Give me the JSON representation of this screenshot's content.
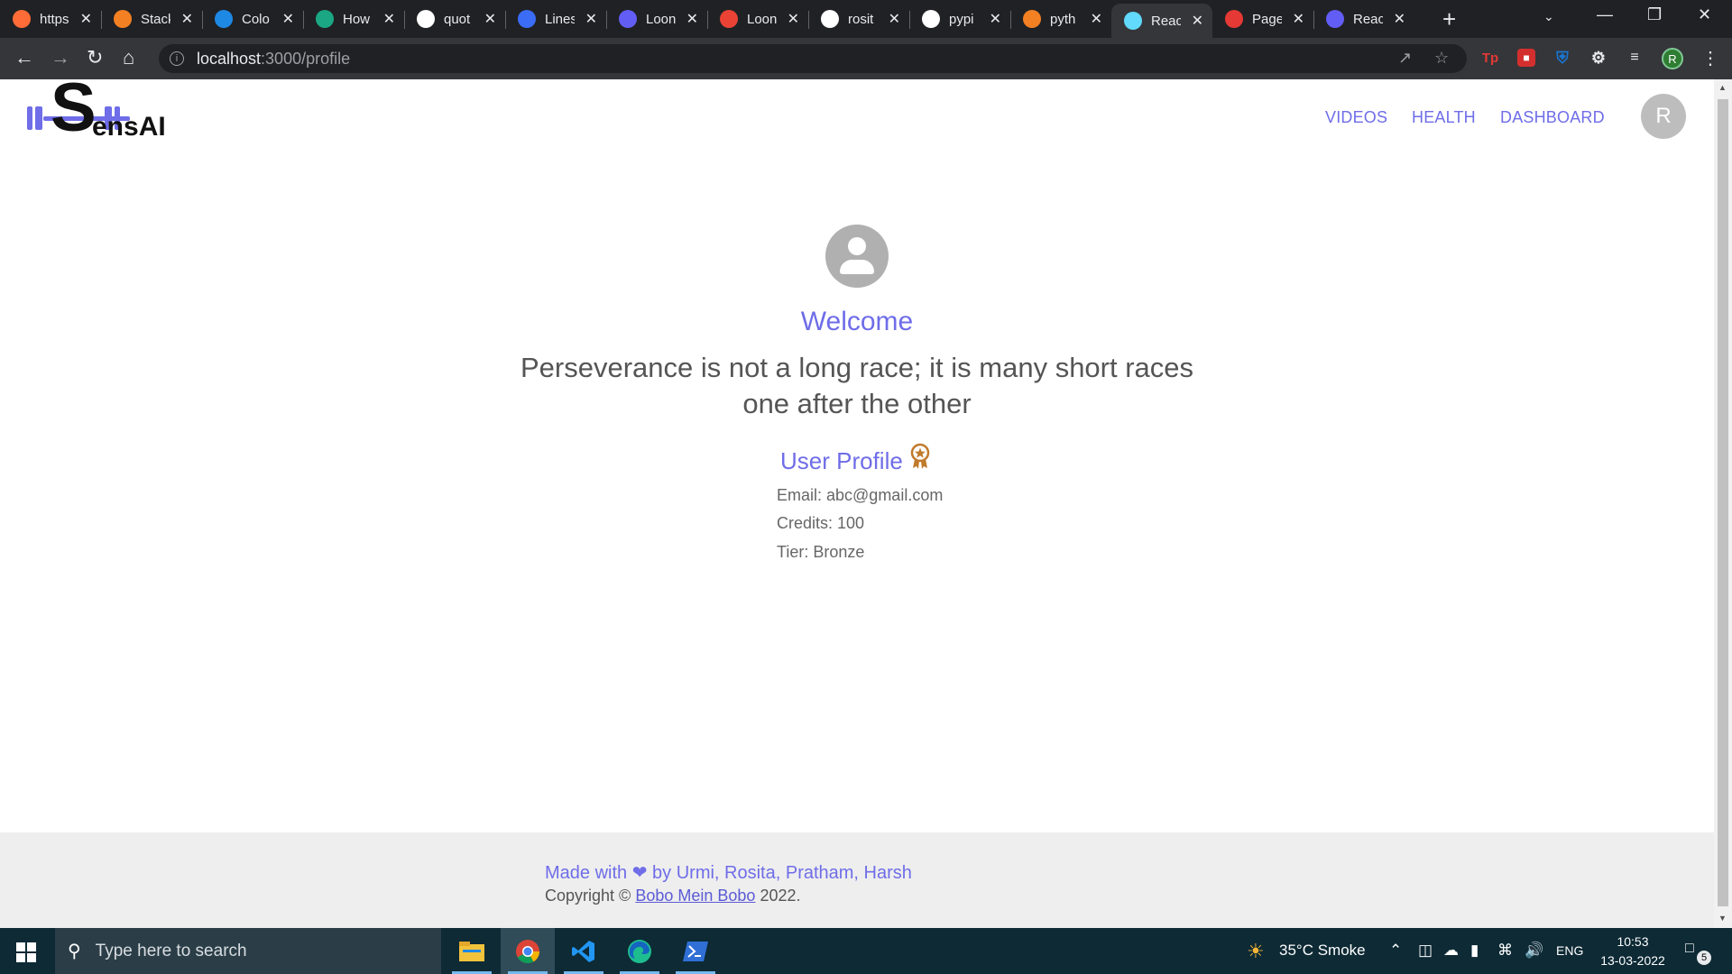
{
  "browser": {
    "tabs": [
      {
        "title": "https",
        "icon": "postman-icon",
        "color": "#ff6c37"
      },
      {
        "title": "Stack",
        "icon": "stackoverflow-icon",
        "color": "#f48024"
      },
      {
        "title": "Colo",
        "icon": "color-c-icon",
        "color": "#1e88e5"
      },
      {
        "title": "How",
        "icon": "hex-icon",
        "color": "#1ba784"
      },
      {
        "title": "quot",
        "icon": "google-icon",
        "color": "#ffffff"
      },
      {
        "title": "Lines",
        "icon": "doc-icon",
        "color": "#3b6cf6"
      },
      {
        "title": "Loon",
        "icon": "loom-icon",
        "color": "#625df5"
      },
      {
        "title": "Loon",
        "icon": "loom-folder-icon",
        "color": "#ea4335"
      },
      {
        "title": "rosit",
        "icon": "github-icon",
        "color": "#ffffff"
      },
      {
        "title": "pypi",
        "icon": "google-icon",
        "color": "#ffffff"
      },
      {
        "title": "pyth",
        "icon": "stackoverflow-icon",
        "color": "#f48024"
      },
      {
        "title": "Reac",
        "icon": "react-icon",
        "color": "#61dafb",
        "active": true
      },
      {
        "title": "Page",
        "icon": "pdf-icon",
        "color": "#e53935"
      },
      {
        "title": "Reac",
        "icon": "loom-icon",
        "color": "#625df5"
      }
    ],
    "url_host": "localhost",
    "url_path": ":3000/profile",
    "profile_initial": "R"
  },
  "site": {
    "logo_letter": "S",
    "logo_rest": "ensAI",
    "nav": {
      "videos": "VIDEOS",
      "health": "HEALTH",
      "dashboard": "DASHBOARD"
    },
    "avatar_initial": "R",
    "accent": "#6f6de8"
  },
  "profile": {
    "welcome": "Welcome",
    "quote": "Perseverance is not a long race; it is many short races one after the other",
    "title": "User Profile",
    "email": "Email: abc@gmail.com",
    "credits": "Credits: 100",
    "tier": "Tier: Bronze",
    "tier_color": "#c07a2c"
  },
  "footer": {
    "made_with": "Made with",
    "made_by": "by Urmi, Rosita, Pratham, Harsh",
    "copyright_prefix": "Copyright ©",
    "copyright_link": "Bobo Mein Bobo",
    "copyright_year": "2022."
  },
  "taskbar": {
    "search_placeholder": "Type here to search",
    "weather": "35°C  Smoke",
    "language": "ENG",
    "time": "10:53",
    "date": "13-03-2022",
    "notification_count": "5"
  }
}
